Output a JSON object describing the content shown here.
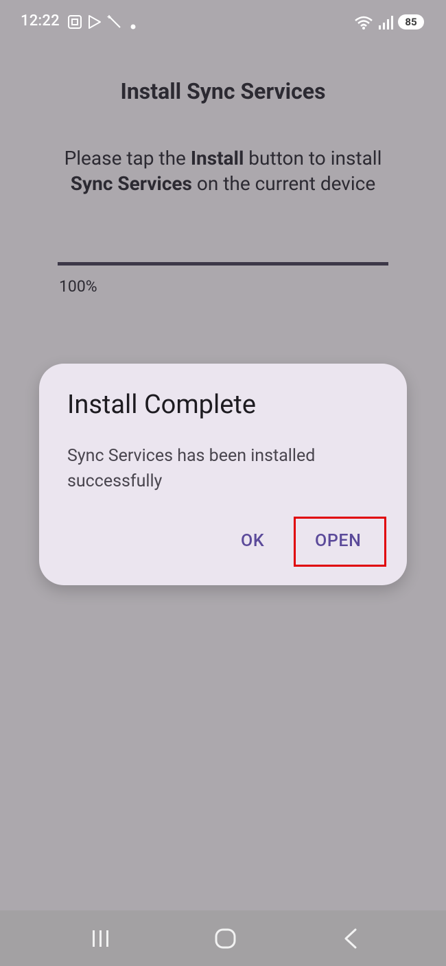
{
  "status_bar": {
    "time": "12:22",
    "battery": "85",
    "icons": [
      "screenshot-icon",
      "play-store-icon",
      "magic-wand-icon",
      "notification-dot-icon",
      "wifi-icon",
      "signal-icon"
    ]
  },
  "page": {
    "title": "Install Sync Services",
    "instruction_part1": "Please tap the ",
    "instruction_bold1": "Install",
    "instruction_part2": " button to install ",
    "instruction_bold2": "Sync Services",
    "instruction_part3": " on the current device",
    "progress_value": 1.0,
    "progress_text": "100%"
  },
  "dialog": {
    "title": "Install Complete",
    "message": "Sync Services has been installed successfully",
    "ok_label": "OK",
    "open_label": "OPEN"
  },
  "nav_bar": {
    "icons": [
      "recents-icon",
      "home-icon",
      "back-icon"
    ]
  },
  "colors": {
    "background": "#aca8ad",
    "dialog_bg": "#ebe5ef",
    "accent": "#5b4a9a",
    "highlight": "#e00007"
  }
}
